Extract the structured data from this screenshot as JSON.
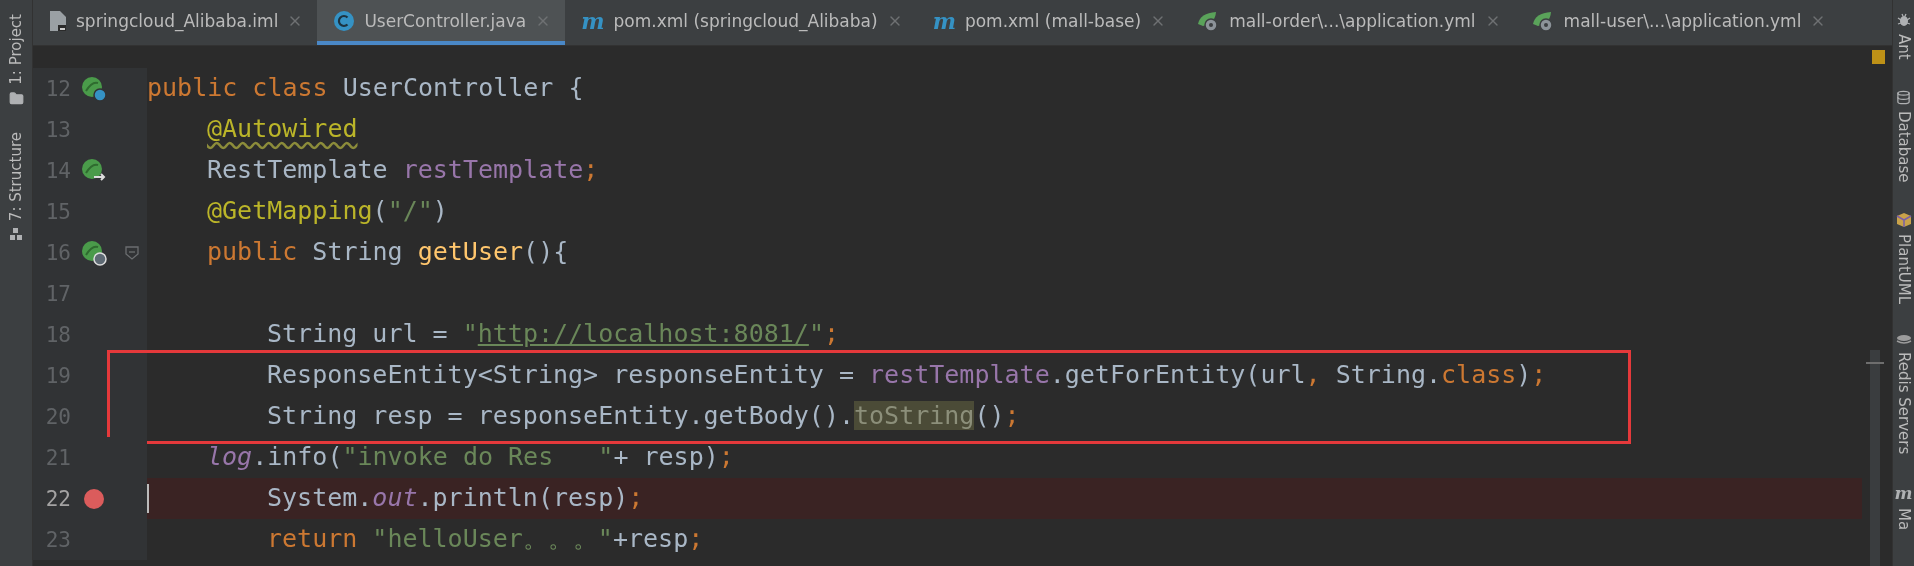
{
  "tabs": [
    {
      "label": "springcloud_Alibaba.iml",
      "kind": "file",
      "selected": false
    },
    {
      "label": "UserController.java",
      "kind": "class",
      "selected": true
    },
    {
      "label": "pom.xml (springcloud_Alibaba)",
      "kind": "maven",
      "icon_text": "m",
      "selected": false
    },
    {
      "label": "pom.xml (mall-base)",
      "kind": "maven",
      "icon_text": "m",
      "selected": false
    },
    {
      "label": "mall-order\\...\\application.yml",
      "kind": "spring",
      "selected": false
    },
    {
      "label": "mall-user\\...\\application.yml",
      "kind": "spring",
      "selected": false
    }
  ],
  "left_tools": [
    {
      "label": "1: Project",
      "kind": "folder"
    },
    {
      "label": "7: Structure",
      "kind": "structure"
    }
  ],
  "right_tools": [
    {
      "label": "Ant",
      "kind": "bug"
    },
    {
      "label": "Database",
      "kind": "database"
    },
    {
      "label": "PlantUML",
      "kind": "cube"
    },
    {
      "label": "Redis Servers",
      "kind": "redis"
    },
    {
      "label": "Ma",
      "kind": "maven",
      "icon_text": "m"
    }
  ],
  "editor": {
    "lines": [
      {
        "number": "12",
        "gutter_icon": {
          "kind": "class"
        },
        "fold": false,
        "breakpoint": false,
        "boxed": false,
        "caret": false,
        "tokens": [
          {
            "text": "public class ",
            "kind": "keyword"
          },
          {
            "text": "UserController {",
            "kind": "plain"
          }
        ],
        "children": [
          {
            "number": "13",
            "fold": false,
            "breakpoint": false,
            "boxed": false,
            "caret": false,
            "tokens": [
              {
                "text": "@Autowired",
                "kind": "annotation-warn"
              }
            ]
          },
          {
            "number": "14",
            "gutter_icon": {
              "kind": "autowire"
            },
            "fold": false,
            "breakpoint": false,
            "boxed": false,
            "caret": false,
            "tokens": [
              {
                "text": "RestTemplate ",
                "kind": "plain"
              },
              {
                "text": "restTemplate",
                "kind": "field"
              },
              {
                "text": ";",
                "kind": "keyword"
              }
            ]
          },
          {
            "number": "15",
            "fold": false,
            "breakpoint": false,
            "boxed": false,
            "caret": false,
            "tokens": [
              {
                "text": "@GetMapping",
                "kind": "annotation"
              },
              {
                "text": "(",
                "kind": "plain"
              },
              {
                "text": "\"/\"",
                "kind": "string"
              },
              {
                "text": ")",
                "kind": "plain"
              }
            ]
          },
          {
            "number": "16",
            "gutter_icon": {
              "kind": "web"
            },
            "fold": true,
            "breakpoint": false,
            "boxed": false,
            "caret": false,
            "tokens": [
              {
                "text": "public ",
                "kind": "keyword"
              },
              {
                "text": "String ",
                "kind": "plain"
              },
              {
                "text": "getUser",
                "kind": "method"
              },
              {
                "text": "(){",
                "kind": "plain"
              }
            ],
            "children": [
              {
                "number": "17",
                "fold": false,
                "breakpoint": false,
                "boxed": false,
                "caret": false
              },
              {
                "number": "18",
                "fold": false,
                "breakpoint": false,
                "boxed": false,
                "caret": false,
                "tokens": [
                  {
                    "text": "String url = ",
                    "kind": "plain"
                  },
                  {
                    "text": "\"",
                    "kind": "string"
                  },
                  {
                    "text": "http://localhost:8081/",
                    "kind": "link"
                  },
                  {
                    "text": "\"",
                    "kind": "string"
                  },
                  {
                    "text": ";",
                    "kind": "keyword"
                  }
                ]
              },
              {
                "number": "19",
                "fold": false,
                "breakpoint": false,
                "boxed": true,
                "caret": false,
                "tokens": [
                  {
                    "text": "ResponseEntity<String> responseEntity = ",
                    "kind": "plain"
                  },
                  {
                    "text": "restTemplate",
                    "kind": "field"
                  },
                  {
                    "text": ".getForEntity(url",
                    "kind": "plain"
                  },
                  {
                    "text": ", ",
                    "kind": "keyword"
                  },
                  {
                    "text": "String.",
                    "kind": "plain"
                  },
                  {
                    "text": "class",
                    "kind": "keyword"
                  },
                  {
                    "text": ")",
                    "kind": "plain"
                  },
                  {
                    "text": ";",
                    "kind": "keyword"
                  }
                ]
              },
              {
                "number": "20",
                "fold": false,
                "breakpoint": false,
                "boxed": true,
                "caret": false,
                "tokens": [
                  {
                    "text": "String resp = responseEntity.getBody().",
                    "kind": "plain"
                  },
                  {
                    "text": "toString",
                    "kind": "highlight"
                  },
                  {
                    "text": "()",
                    "kind": "plain"
                  },
                  {
                    "text": ";",
                    "kind": "keyword"
                  }
                ]
              }
            ]
          },
          {
            "number": "21",
            "fold": false,
            "breakpoint": false,
            "boxed": false,
            "caret": false,
            "tokens": [
              {
                "text": "log",
                "kind": "static"
              },
              {
                "text": ".info(",
                "kind": "plain"
              },
              {
                "text": "\"invoke do Res   \"",
                "kind": "string"
              },
              {
                "text": "+ resp)",
                "kind": "plain"
              },
              {
                "text": ";",
                "kind": "keyword"
              }
            ],
            "children": [
              {
                "number": "22",
                "fold": false,
                "breakpoint": true,
                "boxed": false,
                "caret": true,
                "tokens": [
                  {
                    "text": "System.",
                    "kind": "plain"
                  },
                  {
                    "text": "out",
                    "kind": "static"
                  },
                  {
                    "text": ".println(resp)",
                    "kind": "plain"
                  },
                  {
                    "text": ";",
                    "kind": "keyword"
                  }
                ]
              },
              {
                "number": "23",
                "fold": false,
                "breakpoint": false,
                "boxed": false,
                "caret": false,
                "tokens": [
                  {
                    "text": "return ",
                    "kind": "keyword"
                  },
                  {
                    "text": "\"helloUser。。。\"",
                    "kind": "string"
                  },
                  {
                    "text": "+resp",
                    "kind": "plain"
                  },
                  {
                    "text": ";",
                    "kind": "keyword"
                  }
                ]
              }
            ]
          }
        ]
      }
    ]
  }
}
